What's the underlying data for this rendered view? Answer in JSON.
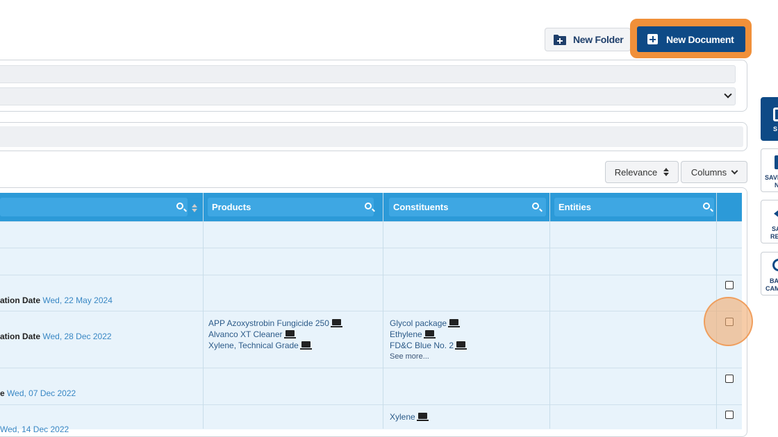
{
  "toolbar": {
    "new_folder_label": "New Folder",
    "new_document_label": "New Document"
  },
  "sort": {
    "relevance_label": "Relevance",
    "columns_label": "Columns"
  },
  "table": {
    "columns": [
      "Products",
      "Constituents",
      "Entities"
    ],
    "rows": [
      {
        "label": "",
        "date": ""
      },
      {
        "label": "",
        "date": ""
      },
      {
        "label": "ation Date",
        "date": "Wed, 22 May 2024"
      },
      {
        "label": "ation Date",
        "date": "Wed, 28 Dec 2022",
        "products": [
          "APP Azoxystrobin Fungicide 250",
          "Alvanco XT Cleaner",
          "Xylene, Technical Grade"
        ],
        "constituents": [
          "Glycol package",
          "Ethylene",
          "FD&C Blue No. 2"
        ],
        "see_more": "See more..."
      },
      {
        "label": "e",
        "date": "Wed, 07 Dec 2022"
      },
      {
        "label": "",
        "date": "Wed, 14 Dec 2022",
        "constituents": [
          "Xylene"
        ]
      }
    ]
  },
  "side_panel": {
    "items": [
      {
        "label_1": "S",
        "label_2": ""
      },
      {
        "label_1": "SAVE",
        "label_2": "N"
      },
      {
        "label_1": "SA",
        "label_2": "RE"
      },
      {
        "label_1": "BA",
        "label_2": "CAM"
      }
    ]
  },
  "colors": {
    "header_blue": "#2c9ad8",
    "primary_button": "#0e4a86",
    "highlight_orange": "#f0903a",
    "row_bg": "#e8f3fb"
  }
}
